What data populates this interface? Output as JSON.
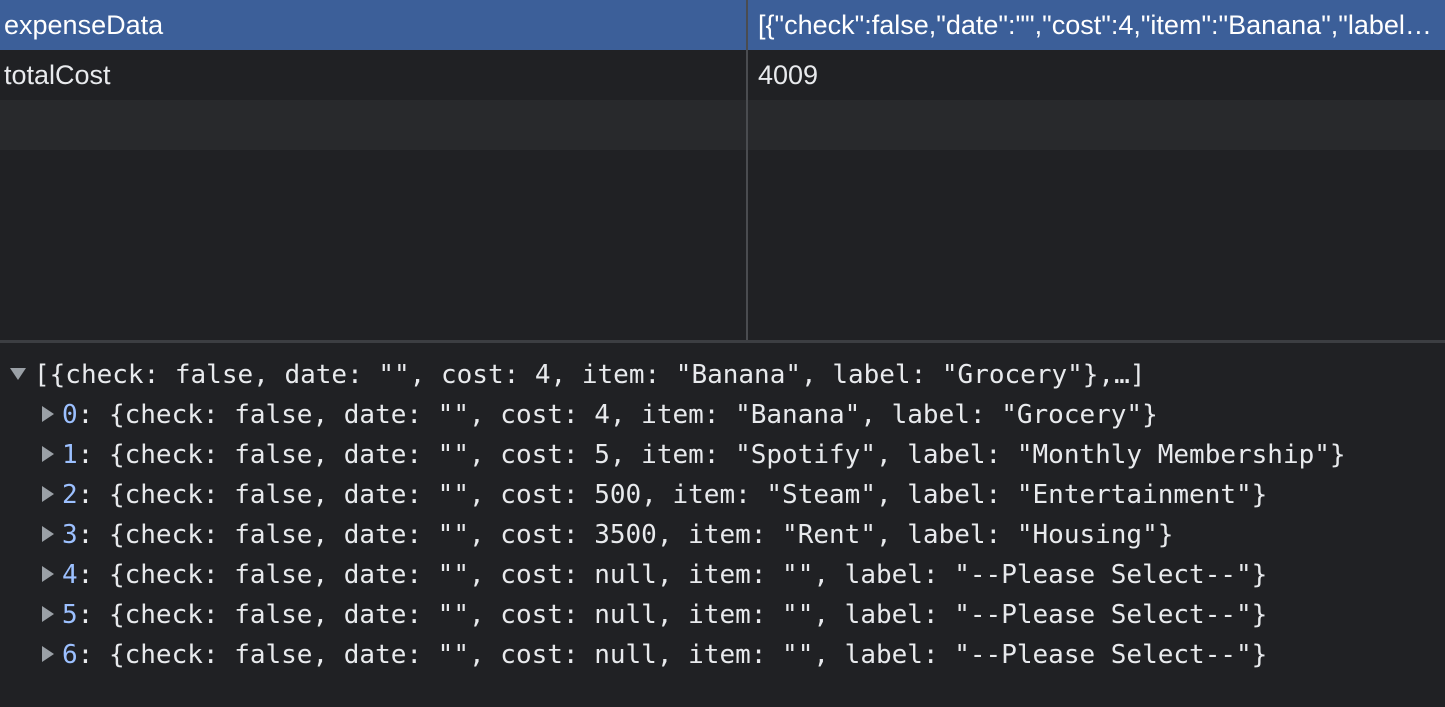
{
  "storage": {
    "rows": [
      {
        "key": "expenseData",
        "value": "[{\"check\":false,\"date\":\"\",\"cost\":4,\"item\":\"Banana\",\"label\":\"Grocery\"},{\"check\":false,\"date\":\"\",\"cost\":5,\"item\":\"Spotify\",\"label\":\"Monthly Membership\"}]"
      },
      {
        "key": "totalCost",
        "value": "4009"
      }
    ]
  },
  "console": {
    "summary": "[{check: false, date: \"\", cost: 4, item: \"Banana\", label: \"Grocery\"},…]",
    "items": [
      {
        "index": "0",
        "text": ": {check: false, date: \"\", cost: 4, item: \"Banana\", label: \"Grocery\"}"
      },
      {
        "index": "1",
        "text": ": {check: false, date: \"\", cost: 5, item: \"Spotify\", label: \"Monthly Membership\"}"
      },
      {
        "index": "2",
        "text": ": {check: false, date: \"\", cost: 500, item: \"Steam\", label: \"Entertainment\"}"
      },
      {
        "index": "3",
        "text": ": {check: false, date: \"\", cost: 3500, item: \"Rent\", label: \"Housing\"}"
      },
      {
        "index": "4",
        "text": ": {check: false, date: \"\", cost: null, item: \"\", label: \"--Please Select--\"}"
      },
      {
        "index": "5",
        "text": ": {check: false, date: \"\", cost: null, item: \"\", label: \"--Please Select--\"}"
      },
      {
        "index": "6",
        "text": ": {check: false, date: \"\", cost: null, item: \"\", label: \"--Please Select--\"}"
      }
    ]
  },
  "colors": {
    "selected_row": "#3c5f99",
    "background": "#202124",
    "alt_row": "#28292c",
    "index_text": "#9cc0ff"
  },
  "icons": {
    "expanded": "triangle-down-icon",
    "collapsed": "triangle-right-icon"
  }
}
